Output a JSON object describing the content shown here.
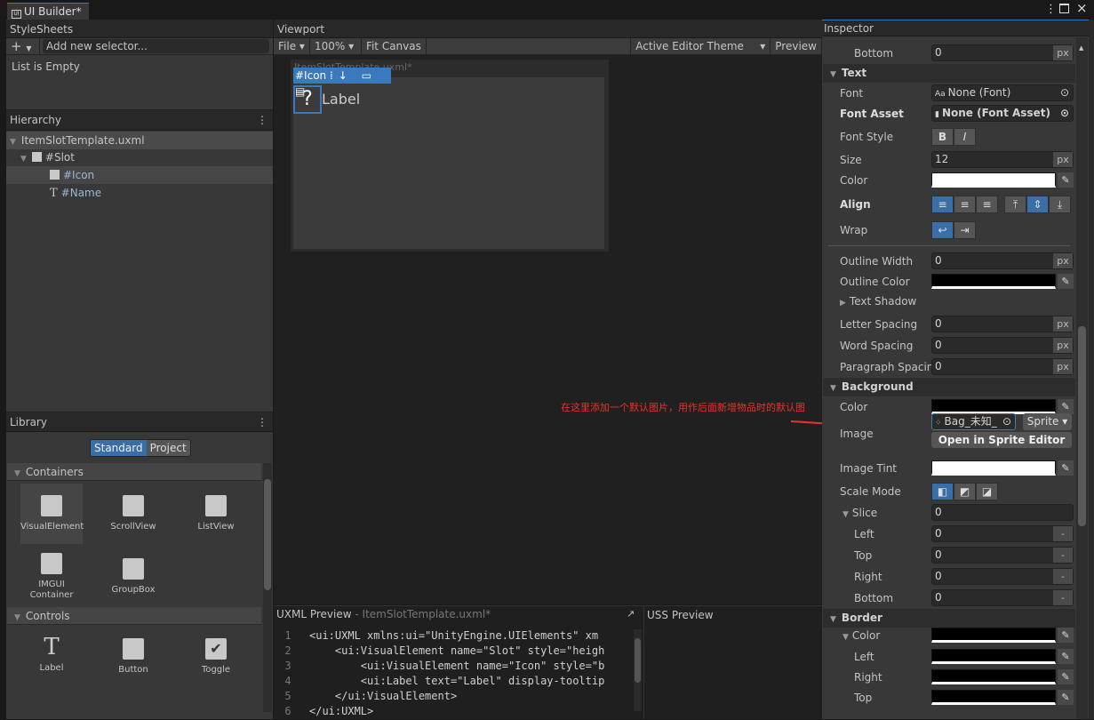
{
  "window": {
    "tab_title": "UI Builder*",
    "tab_icon": "ui-icon",
    "menu_icon": "kebab-menu-icon",
    "maximize_icon": "maximize-icon",
    "close_icon": "close-icon"
  },
  "stylesheets": {
    "title": "StyleSheets",
    "add_icon": "plus-icon",
    "selector_placeholder": "Add new selector...",
    "empty_text": "List is Empty"
  },
  "hierarchy": {
    "title": "Hierarchy",
    "items": [
      {
        "label": "ItemSlotTemplate.uxml",
        "depth": 0,
        "icon": "none"
      },
      {
        "label": "#Slot",
        "depth": 1,
        "icon": "visual-element"
      },
      {
        "label": "#Icon",
        "depth": 2,
        "icon": "visual-element",
        "selected": true
      },
      {
        "label": "#Name",
        "depth": 2,
        "icon": "text"
      }
    ]
  },
  "library": {
    "title": "Library",
    "tabs": [
      "Standard",
      "Project"
    ],
    "active_tab": "Standard",
    "sections": [
      {
        "title": "Containers",
        "items": [
          "VisualElement",
          "ScrollView",
          "ListView",
          "IMGUI Container",
          "GroupBox"
        ]
      },
      {
        "title": "Controls",
        "items": [
          "Label",
          "Button",
          "Toggle"
        ]
      }
    ]
  },
  "viewport": {
    "title": "Viewport",
    "file": "File",
    "zoom": "100%",
    "fit": "Fit Canvas",
    "theme": "Active Editor Theme",
    "preview": "Preview",
    "canvas_title": "ItemSlotTemplate.uxml*",
    "selected_tag": "#Icon",
    "icon_glyph": "?",
    "label_text": "Label"
  },
  "uxml_preview": {
    "title": "UXML Preview",
    "file": "- ItemSlotTemplate.uxml*",
    "lines": [
      "<ui:UXML xmlns:ui=\"UnityEngine.UIElements\" xm",
      "    <ui:VisualElement name=\"Slot\" style=\"heigh",
      "        <ui:VisualElement name=\"Icon\" style=\"b",
      "        <ui:Label text=\"Label\" display-tooltip",
      "    </ui:VisualElement>",
      "</ui:UXML>"
    ]
  },
  "uss_preview": {
    "title": "USS Preview"
  },
  "annotation": {
    "text": "在这里添加一个默认图片，用作后面新增物品时的默认图",
    "color": "#e8322d"
  },
  "inspector": {
    "title": "Inspector",
    "rows": [
      {
        "kind": "px",
        "label": "Bottom",
        "value": "0",
        "unit": "px",
        "indent": 1
      },
      {
        "kind": "head",
        "label": "Text"
      },
      {
        "kind": "obj",
        "label": "Font",
        "value": "None (Font)",
        "icon": "font-icon"
      },
      {
        "kind": "obj",
        "label": "Font Asset",
        "value": "None (Font Asset)",
        "icon": "file-icon",
        "bold": true
      },
      {
        "kind": "buttons",
        "label": "Font Style",
        "buttons": [
          "B",
          "I"
        ]
      },
      {
        "kind": "px",
        "label": "Size",
        "value": "12",
        "unit": "px"
      },
      {
        "kind": "color",
        "label": "Color",
        "color": "#ffffff"
      },
      {
        "kind": "align",
        "label": "Align",
        "bold": true
      },
      {
        "kind": "wrap",
        "label": "Wrap"
      },
      {
        "kind": "px",
        "label": "Outline Width",
        "value": "0",
        "unit": "px"
      },
      {
        "kind": "color",
        "label": "Outline Color",
        "color": "#000000"
      },
      {
        "kind": "fold",
        "label": "Text Shadow"
      },
      {
        "kind": "px",
        "label": "Letter Spacing",
        "value": "0",
        "unit": "px"
      },
      {
        "kind": "px",
        "label": "Word Spacing",
        "value": "0",
        "unit": "px"
      },
      {
        "kind": "px",
        "label": "Paragraph Spacing",
        "value": "0",
        "unit": "px"
      },
      {
        "kind": "head",
        "label": "Background"
      },
      {
        "kind": "color",
        "label": "Color",
        "color": "#000000"
      },
      {
        "kind": "image",
        "label": "Image",
        "value": "Bag_未知_",
        "type": "Sprite",
        "button": "Open in Sprite Editor"
      },
      {
        "kind": "color",
        "label": "Image Tint",
        "color": "#ffffff"
      },
      {
        "kind": "scale",
        "label": "Scale Mode"
      },
      {
        "kind": "num",
        "label": "Slice",
        "value": "0",
        "indent": 1,
        "fold": true
      },
      {
        "kind": "px",
        "label": "Left",
        "value": "0",
        "unit": "-",
        "indent": 1
      },
      {
        "kind": "px",
        "label": "Top",
        "value": "0",
        "unit": "-",
        "indent": 1
      },
      {
        "kind": "px",
        "label": "Right",
        "value": "0",
        "unit": "-",
        "indent": 1
      },
      {
        "kind": "px",
        "label": "Bottom",
        "value": "0",
        "unit": "-",
        "indent": 1
      },
      {
        "kind": "head",
        "label": "Border"
      },
      {
        "kind": "color",
        "label": "Color",
        "color": "#000000",
        "indent": 1,
        "fold": true
      },
      {
        "kind": "color",
        "label": "Left",
        "color": "#000000",
        "indent": 1
      },
      {
        "kind": "color",
        "label": "Right",
        "color": "#000000",
        "indent": 1
      },
      {
        "kind": "color",
        "label": "Top",
        "color": "#000000",
        "indent": 1
      }
    ]
  }
}
